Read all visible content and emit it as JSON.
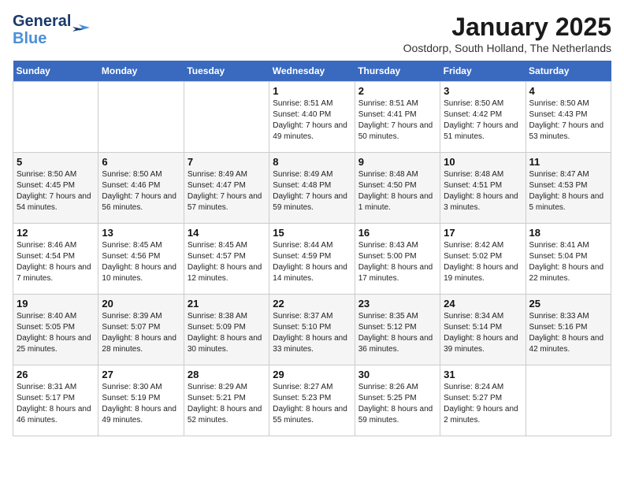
{
  "logo": {
    "line1": "General",
    "line2": "Blue"
  },
  "title": "January 2025",
  "subtitle": "Oostdorp, South Holland, The Netherlands",
  "weekdays": [
    "Sunday",
    "Monday",
    "Tuesday",
    "Wednesday",
    "Thursday",
    "Friday",
    "Saturday"
  ],
  "weeks": [
    [
      {
        "day": "",
        "sunrise": "",
        "sunset": "",
        "daylight": ""
      },
      {
        "day": "",
        "sunrise": "",
        "sunset": "",
        "daylight": ""
      },
      {
        "day": "",
        "sunrise": "",
        "sunset": "",
        "daylight": ""
      },
      {
        "day": "1",
        "sunrise": "Sunrise: 8:51 AM",
        "sunset": "Sunset: 4:40 PM",
        "daylight": "Daylight: 7 hours and 49 minutes."
      },
      {
        "day": "2",
        "sunrise": "Sunrise: 8:51 AM",
        "sunset": "Sunset: 4:41 PM",
        "daylight": "Daylight: 7 hours and 50 minutes."
      },
      {
        "day": "3",
        "sunrise": "Sunrise: 8:50 AM",
        "sunset": "Sunset: 4:42 PM",
        "daylight": "Daylight: 7 hours and 51 minutes."
      },
      {
        "day": "4",
        "sunrise": "Sunrise: 8:50 AM",
        "sunset": "Sunset: 4:43 PM",
        "daylight": "Daylight: 7 hours and 53 minutes."
      }
    ],
    [
      {
        "day": "5",
        "sunrise": "Sunrise: 8:50 AM",
        "sunset": "Sunset: 4:45 PM",
        "daylight": "Daylight: 7 hours and 54 minutes."
      },
      {
        "day": "6",
        "sunrise": "Sunrise: 8:50 AM",
        "sunset": "Sunset: 4:46 PM",
        "daylight": "Daylight: 7 hours and 56 minutes."
      },
      {
        "day": "7",
        "sunrise": "Sunrise: 8:49 AM",
        "sunset": "Sunset: 4:47 PM",
        "daylight": "Daylight: 7 hours and 57 minutes."
      },
      {
        "day": "8",
        "sunrise": "Sunrise: 8:49 AM",
        "sunset": "Sunset: 4:48 PM",
        "daylight": "Daylight: 7 hours and 59 minutes."
      },
      {
        "day": "9",
        "sunrise": "Sunrise: 8:48 AM",
        "sunset": "Sunset: 4:50 PM",
        "daylight": "Daylight: 8 hours and 1 minute."
      },
      {
        "day": "10",
        "sunrise": "Sunrise: 8:48 AM",
        "sunset": "Sunset: 4:51 PM",
        "daylight": "Daylight: 8 hours and 3 minutes."
      },
      {
        "day": "11",
        "sunrise": "Sunrise: 8:47 AM",
        "sunset": "Sunset: 4:53 PM",
        "daylight": "Daylight: 8 hours and 5 minutes."
      }
    ],
    [
      {
        "day": "12",
        "sunrise": "Sunrise: 8:46 AM",
        "sunset": "Sunset: 4:54 PM",
        "daylight": "Daylight: 8 hours and 7 minutes."
      },
      {
        "day": "13",
        "sunrise": "Sunrise: 8:45 AM",
        "sunset": "Sunset: 4:56 PM",
        "daylight": "Daylight: 8 hours and 10 minutes."
      },
      {
        "day": "14",
        "sunrise": "Sunrise: 8:45 AM",
        "sunset": "Sunset: 4:57 PM",
        "daylight": "Daylight: 8 hours and 12 minutes."
      },
      {
        "day": "15",
        "sunrise": "Sunrise: 8:44 AM",
        "sunset": "Sunset: 4:59 PM",
        "daylight": "Daylight: 8 hours and 14 minutes."
      },
      {
        "day": "16",
        "sunrise": "Sunrise: 8:43 AM",
        "sunset": "Sunset: 5:00 PM",
        "daylight": "Daylight: 8 hours and 17 minutes."
      },
      {
        "day": "17",
        "sunrise": "Sunrise: 8:42 AM",
        "sunset": "Sunset: 5:02 PM",
        "daylight": "Daylight: 8 hours and 19 minutes."
      },
      {
        "day": "18",
        "sunrise": "Sunrise: 8:41 AM",
        "sunset": "Sunset: 5:04 PM",
        "daylight": "Daylight: 8 hours and 22 minutes."
      }
    ],
    [
      {
        "day": "19",
        "sunrise": "Sunrise: 8:40 AM",
        "sunset": "Sunset: 5:05 PM",
        "daylight": "Daylight: 8 hours and 25 minutes."
      },
      {
        "day": "20",
        "sunrise": "Sunrise: 8:39 AM",
        "sunset": "Sunset: 5:07 PM",
        "daylight": "Daylight: 8 hours and 28 minutes."
      },
      {
        "day": "21",
        "sunrise": "Sunrise: 8:38 AM",
        "sunset": "Sunset: 5:09 PM",
        "daylight": "Daylight: 8 hours and 30 minutes."
      },
      {
        "day": "22",
        "sunrise": "Sunrise: 8:37 AM",
        "sunset": "Sunset: 5:10 PM",
        "daylight": "Daylight: 8 hours and 33 minutes."
      },
      {
        "day": "23",
        "sunrise": "Sunrise: 8:35 AM",
        "sunset": "Sunset: 5:12 PM",
        "daylight": "Daylight: 8 hours and 36 minutes."
      },
      {
        "day": "24",
        "sunrise": "Sunrise: 8:34 AM",
        "sunset": "Sunset: 5:14 PM",
        "daylight": "Daylight: 8 hours and 39 minutes."
      },
      {
        "day": "25",
        "sunrise": "Sunrise: 8:33 AM",
        "sunset": "Sunset: 5:16 PM",
        "daylight": "Daylight: 8 hours and 42 minutes."
      }
    ],
    [
      {
        "day": "26",
        "sunrise": "Sunrise: 8:31 AM",
        "sunset": "Sunset: 5:17 PM",
        "daylight": "Daylight: 8 hours and 46 minutes."
      },
      {
        "day": "27",
        "sunrise": "Sunrise: 8:30 AM",
        "sunset": "Sunset: 5:19 PM",
        "daylight": "Daylight: 8 hours and 49 minutes."
      },
      {
        "day": "28",
        "sunrise": "Sunrise: 8:29 AM",
        "sunset": "Sunset: 5:21 PM",
        "daylight": "Daylight: 8 hours and 52 minutes."
      },
      {
        "day": "29",
        "sunrise": "Sunrise: 8:27 AM",
        "sunset": "Sunset: 5:23 PM",
        "daylight": "Daylight: 8 hours and 55 minutes."
      },
      {
        "day": "30",
        "sunrise": "Sunrise: 8:26 AM",
        "sunset": "Sunset: 5:25 PM",
        "daylight": "Daylight: 8 hours and 59 minutes."
      },
      {
        "day": "31",
        "sunrise": "Sunrise: 8:24 AM",
        "sunset": "Sunset: 5:27 PM",
        "daylight": "Daylight: 9 hours and 2 minutes."
      },
      {
        "day": "",
        "sunrise": "",
        "sunset": "",
        "daylight": ""
      }
    ]
  ]
}
